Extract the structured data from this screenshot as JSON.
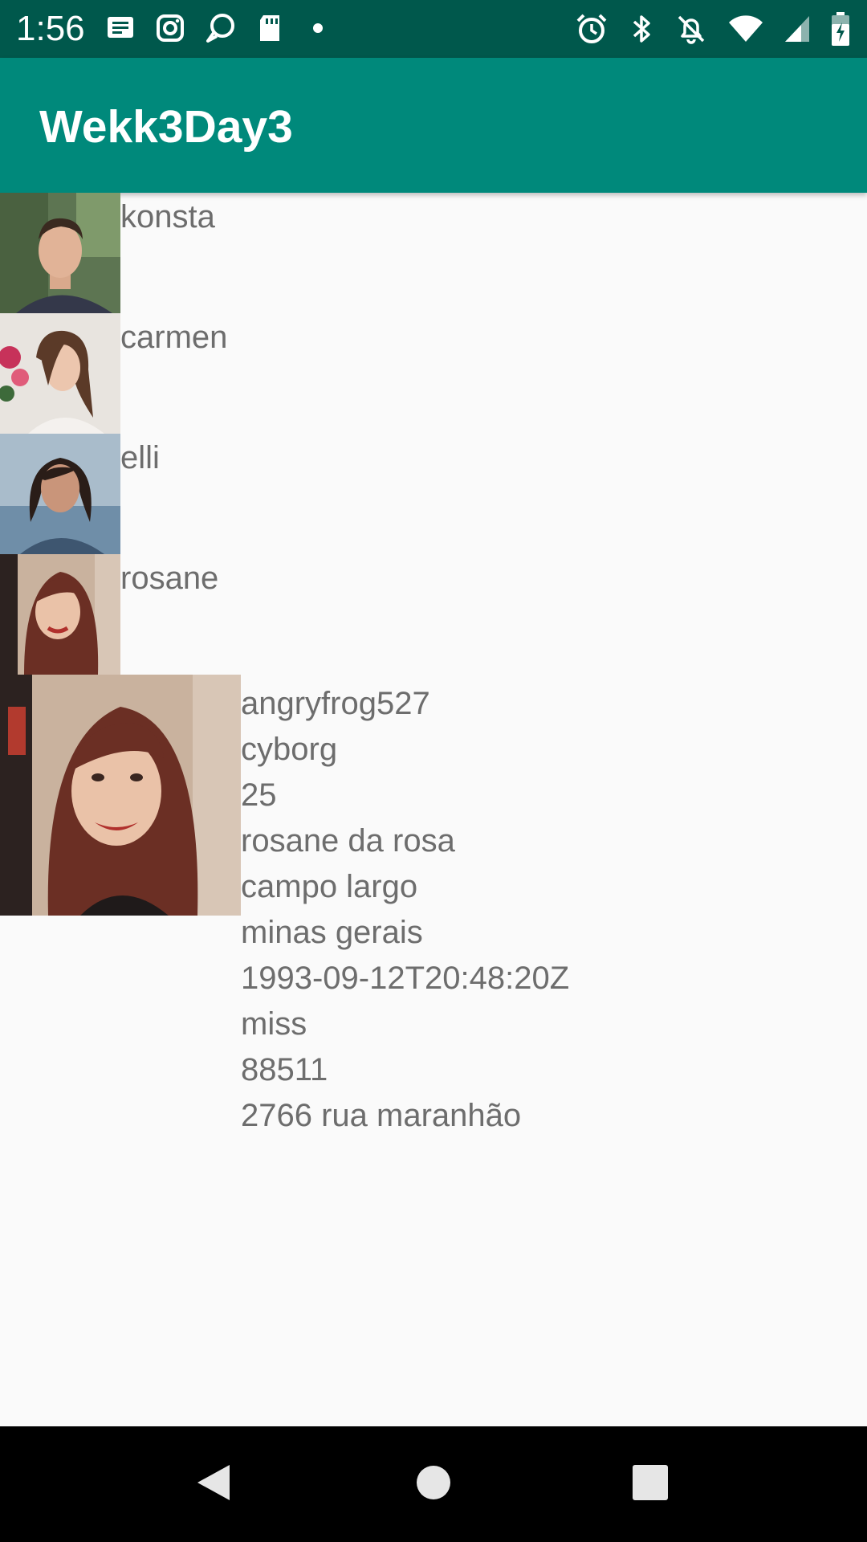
{
  "status_bar": {
    "time": "1:56",
    "left_icons": [
      "message-icon",
      "instagram-icon",
      "chat-bubble-icon",
      "sd-card-icon",
      "dot-icon"
    ],
    "right_icons": [
      "alarm-icon",
      "bluetooth-icon",
      "notifications-off-icon",
      "wifi-icon",
      "cell-signal-icon",
      "battery-charging-icon"
    ]
  },
  "app_bar": {
    "title": "Wekk3Day3",
    "color": "#00897b"
  },
  "list": {
    "items": [
      {
        "name": "konsta"
      },
      {
        "name": "carmen"
      },
      {
        "name": "elli"
      },
      {
        "name": "rosane"
      }
    ]
  },
  "detail": {
    "lines": [
      "angryfrog527",
      "cyborg",
      "25",
      "rosane da rosa",
      "campo largo",
      "minas gerais",
      "1993-09-12T20:48:20Z",
      "miss",
      "88511",
      "2766 rua maranhão"
    ]
  },
  "nav_bar": {
    "buttons": [
      "back-icon",
      "home-icon",
      "recents-icon"
    ]
  }
}
